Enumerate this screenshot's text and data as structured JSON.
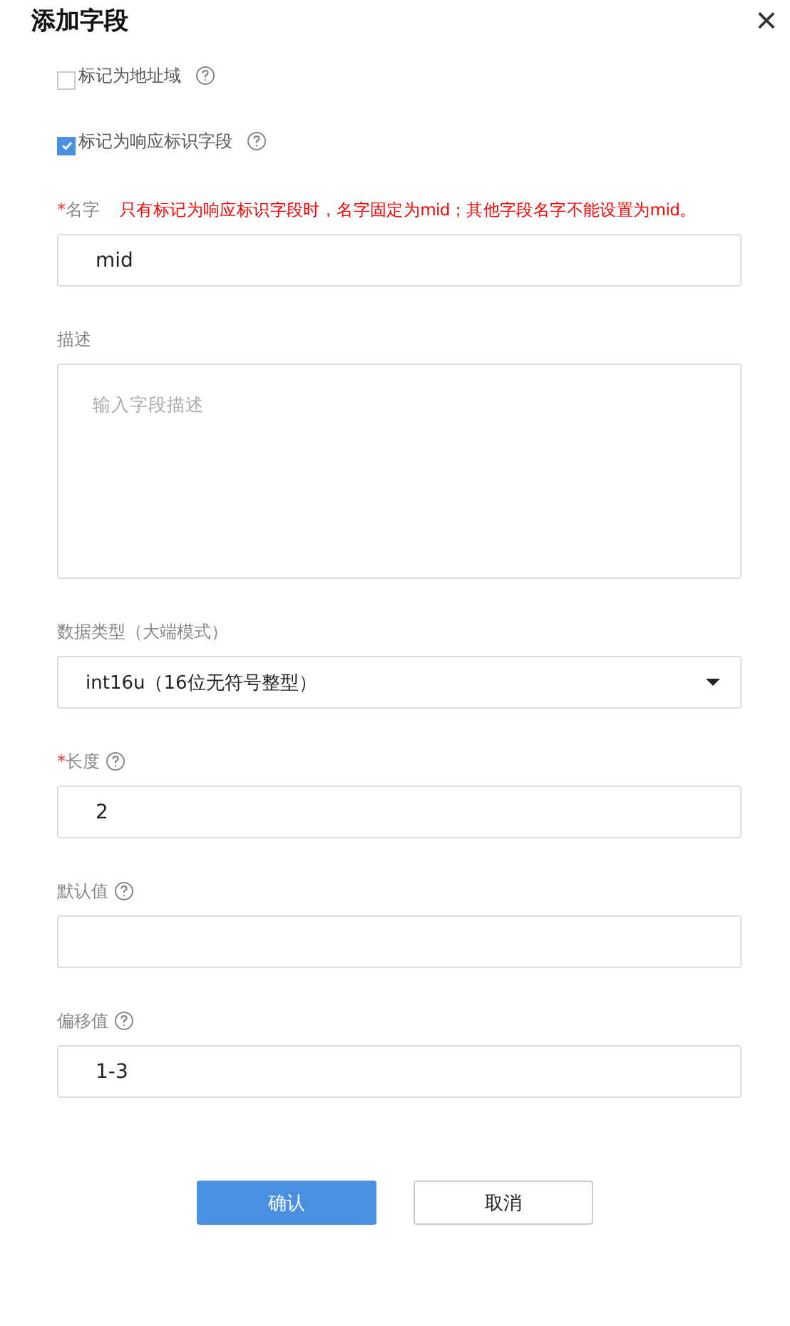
{
  "dialog": {
    "title": "添加字段",
    "close_glyph": "×"
  },
  "checkboxes": [
    {
      "label": "标记为地址域",
      "checked": false,
      "help": true
    },
    {
      "label": "标记为响应标识字段",
      "checked": true,
      "help": true
    }
  ],
  "fields": [
    {
      "kind": "text",
      "label": "名字",
      "required_mark": "*",
      "help": false,
      "note": "只有标记为响应标识字段时，名字固定为mid；其他字段名字不能设置为mid。",
      "value": "mid"
    },
    {
      "kind": "textarea",
      "label": "描述",
      "help": false,
      "placeholder": "输入字段描述"
    },
    {
      "kind": "select",
      "label": "数据类型（大端模式）",
      "help": false,
      "value": "int16u（16位无符号整型）"
    },
    {
      "kind": "text",
      "label": "长度",
      "required_mark": "*",
      "help": true,
      "value": "2"
    },
    {
      "kind": "text",
      "label": "默认值",
      "help": true
    },
    {
      "kind": "text",
      "label": "偏移值",
      "help": true,
      "value": "1-3"
    }
  ],
  "buttons": [
    {
      "label": "确认",
      "kind": "primary"
    },
    {
      "label": "取消",
      "kind": "default"
    }
  ]
}
